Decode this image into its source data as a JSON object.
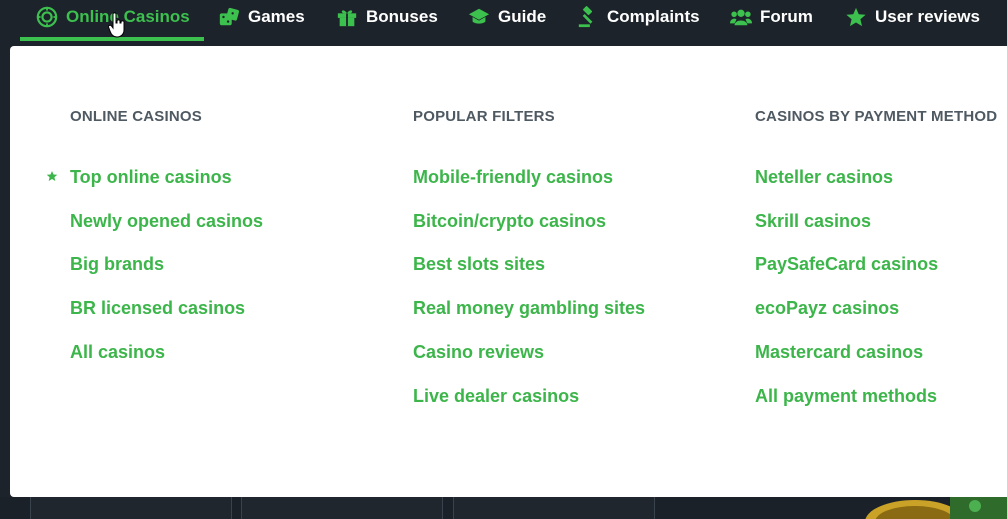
{
  "nav": {
    "items": [
      {
        "label": "Online Casinos",
        "icon": "casino-chip-icon",
        "active": true
      },
      {
        "label": "Games",
        "icon": "dice-icon"
      },
      {
        "label": "Bonuses",
        "icon": "gift-icon"
      },
      {
        "label": "Guide",
        "icon": "graduation-cap-icon"
      },
      {
        "label": "Complaints",
        "icon": "gavel-icon"
      },
      {
        "label": "Forum",
        "icon": "users-icon"
      },
      {
        "label": "User reviews",
        "icon": "star-icon"
      }
    ]
  },
  "dropdown": {
    "columns": [
      {
        "heading": "ONLINE CASINOS",
        "links": [
          "Top online casinos",
          "Newly opened casinos",
          "Big brands",
          "BR licensed casinos",
          "All casinos"
        ]
      },
      {
        "heading": "POPULAR FILTERS",
        "links": [
          "Mobile-friendly casinos",
          "Bitcoin/crypto casinos",
          "Best slots sites",
          "Real money gambling sites",
          "Casino reviews",
          "Live dealer casinos"
        ]
      },
      {
        "heading": "CASINOS BY PAYMENT METHOD",
        "links": [
          "Neteller casinos",
          "Skrill casinos",
          "PaySafeCard casinos",
          "ecoPayz casinos",
          "Mastercard casinos",
          "All payment methods"
        ]
      }
    ]
  },
  "colors": {
    "accent": "#3cc04e",
    "link": "#3cb54a",
    "heading": "#4e5962",
    "nav_bg": "#1d232b",
    "panel_bg": "#ffffff"
  }
}
